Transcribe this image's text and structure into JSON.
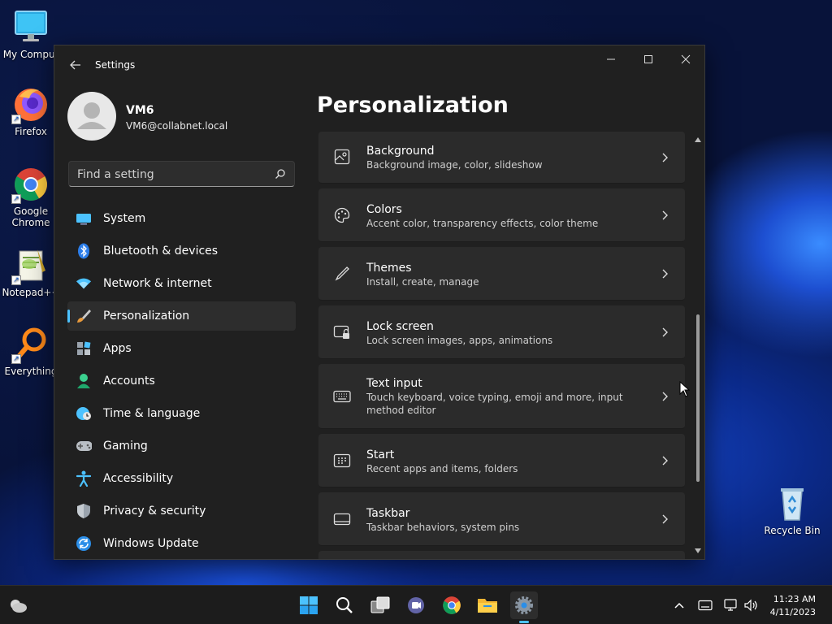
{
  "desktop": {
    "icons": [
      {
        "label": "My Comput"
      },
      {
        "label": "Firefox"
      },
      {
        "label": "Google Chrome"
      },
      {
        "label": "Notepad++"
      },
      {
        "label": "Everything"
      },
      {
        "label": "Recycle Bin"
      }
    ]
  },
  "window": {
    "title": "Settings",
    "profile": {
      "name": "VM6",
      "email": "VM6@collabnet.local"
    },
    "search": {
      "placeholder": "Find a setting"
    },
    "nav": [
      {
        "label": "System",
        "icon": "monitor-icon"
      },
      {
        "label": "Bluetooth & devices",
        "icon": "bluetooth-icon"
      },
      {
        "label": "Network & internet",
        "icon": "wifi-icon"
      },
      {
        "label": "Personalization",
        "icon": "brush-icon",
        "active": true
      },
      {
        "label": "Apps",
        "icon": "apps-icon"
      },
      {
        "label": "Accounts",
        "icon": "person-icon"
      },
      {
        "label": "Time & language",
        "icon": "globe-clock-icon"
      },
      {
        "label": "Gaming",
        "icon": "gamepad-icon"
      },
      {
        "label": "Accessibility",
        "icon": "accessibility-icon"
      },
      {
        "label": "Privacy & security",
        "icon": "shield-icon"
      },
      {
        "label": "Windows Update",
        "icon": "update-icon"
      }
    ],
    "page_title": "Personalization",
    "cards": [
      {
        "title": "Background",
        "subtitle": "Background image, color, slideshow",
        "icon": "image-icon"
      },
      {
        "title": "Colors",
        "subtitle": "Accent color, transparency effects, color theme",
        "icon": "palette-icon"
      },
      {
        "title": "Themes",
        "subtitle": "Install, create, manage",
        "icon": "pen-icon"
      },
      {
        "title": "Lock screen",
        "subtitle": "Lock screen images, apps, animations",
        "icon": "lock-screen-icon"
      },
      {
        "title": "Text input",
        "subtitle": "Touch keyboard, voice typing, emoji and more, input method editor",
        "icon": "keyboard-icon"
      },
      {
        "title": "Start",
        "subtitle": "Recent apps and items, folders",
        "icon": "start-icon"
      },
      {
        "title": "Taskbar",
        "subtitle": "Taskbar behaviors, system pins",
        "icon": "taskbar-icon"
      }
    ]
  },
  "taskbar": {
    "time": "11:23 AM",
    "date": "4/11/2023"
  },
  "colors": {
    "accent": "#4cc2ff",
    "window_bg": "#202020",
    "card_bg": "#2b2b2b"
  }
}
